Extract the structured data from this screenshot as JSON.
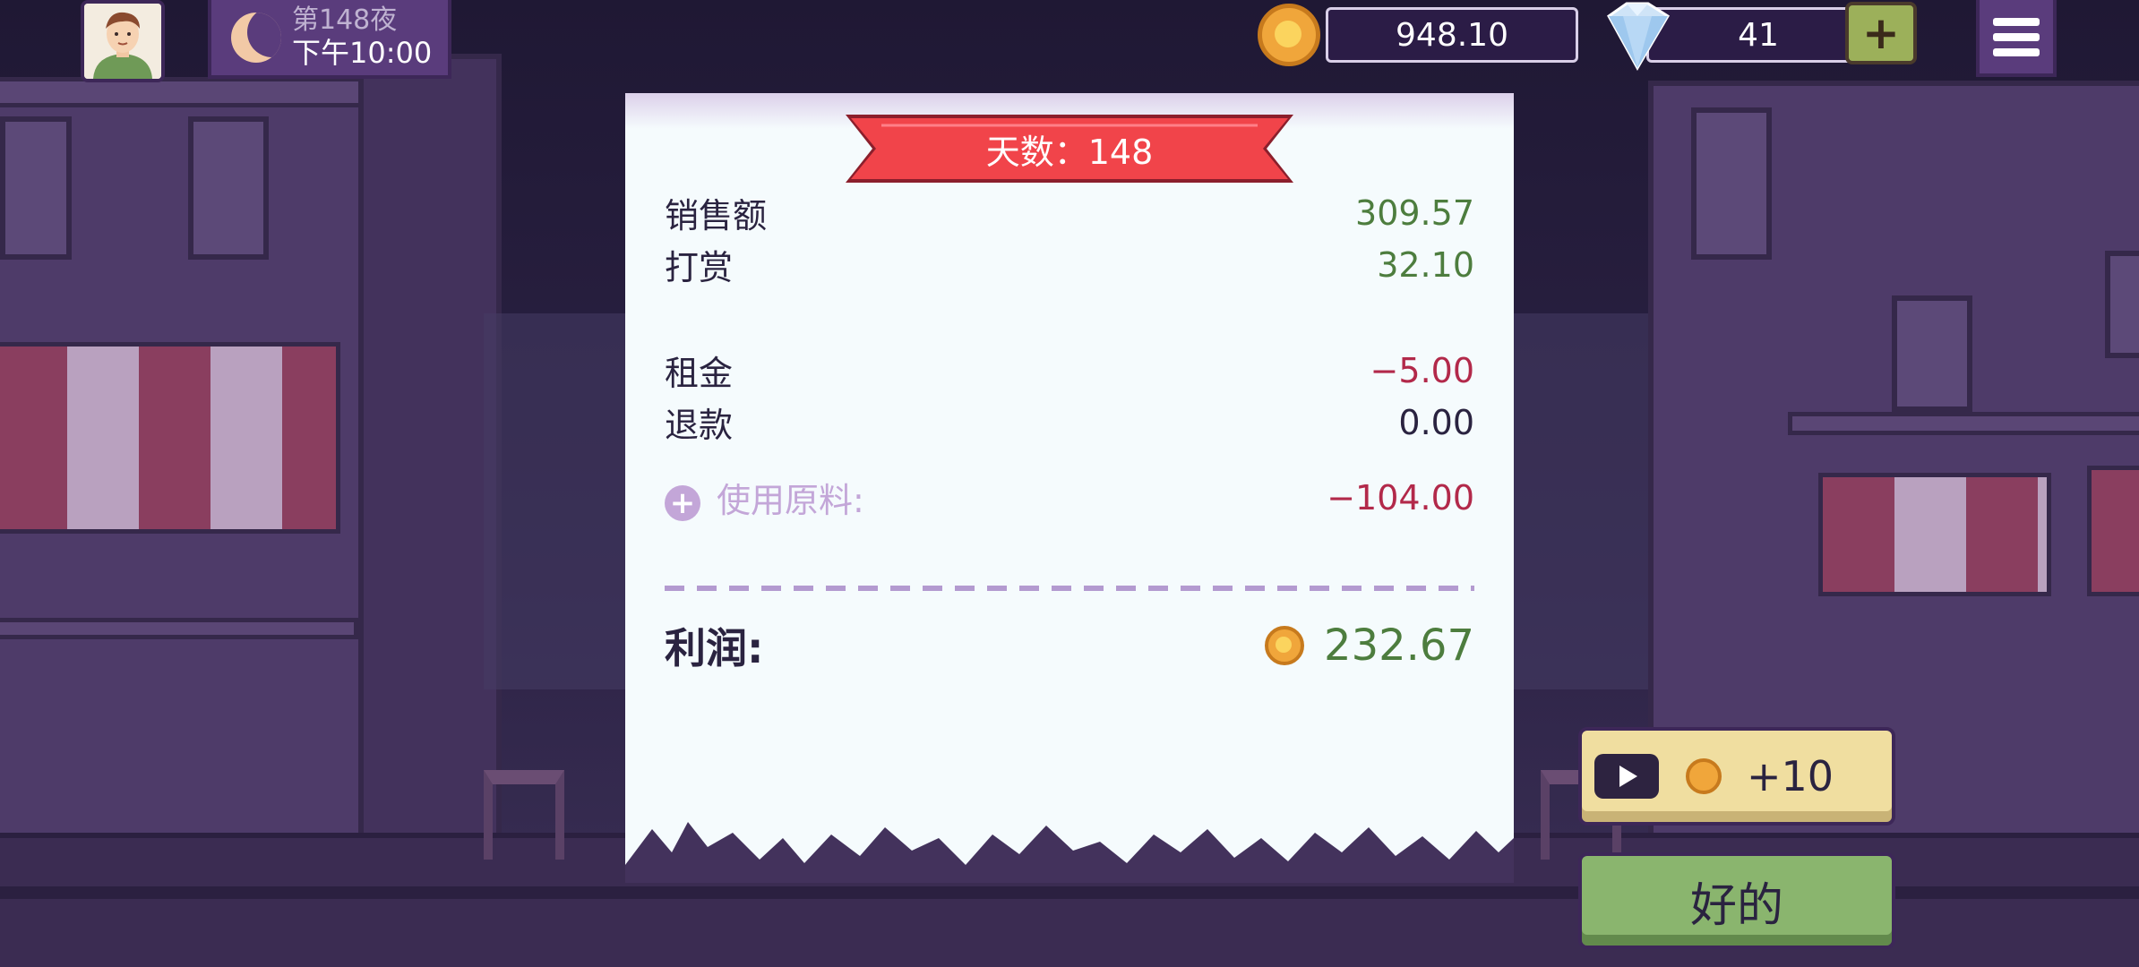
{
  "hud": {
    "night_title": "第148夜",
    "night_time": "下午10:00",
    "coins": "948.10",
    "gems": "41",
    "plus_label": "+"
  },
  "receipt": {
    "banner": "天数：148",
    "rows": {
      "sales_label": "销售额",
      "sales_value": "309.57",
      "tips_label": "打赏",
      "tips_value": "32.10",
      "rent_label": "租金",
      "rent_value": "−5.00",
      "refund_label": "退款",
      "refund_value": "0.00",
      "ingredients_label": "使用原料:",
      "ingredients_value": "−104.00"
    },
    "profit_label": "利润:",
    "profit_value": "232.67"
  },
  "buttons": {
    "ad_reward": "+10",
    "ok": "好的"
  },
  "colors": {
    "positive": "#4d7d3e",
    "negative": "#b2294a",
    "banner": "#f1444a",
    "ok_button": "#8ab56e"
  },
  "icons": [
    "moon-icon",
    "coin-icon",
    "gem-icon",
    "plus-icon",
    "menu-icon",
    "play-icon"
  ]
}
